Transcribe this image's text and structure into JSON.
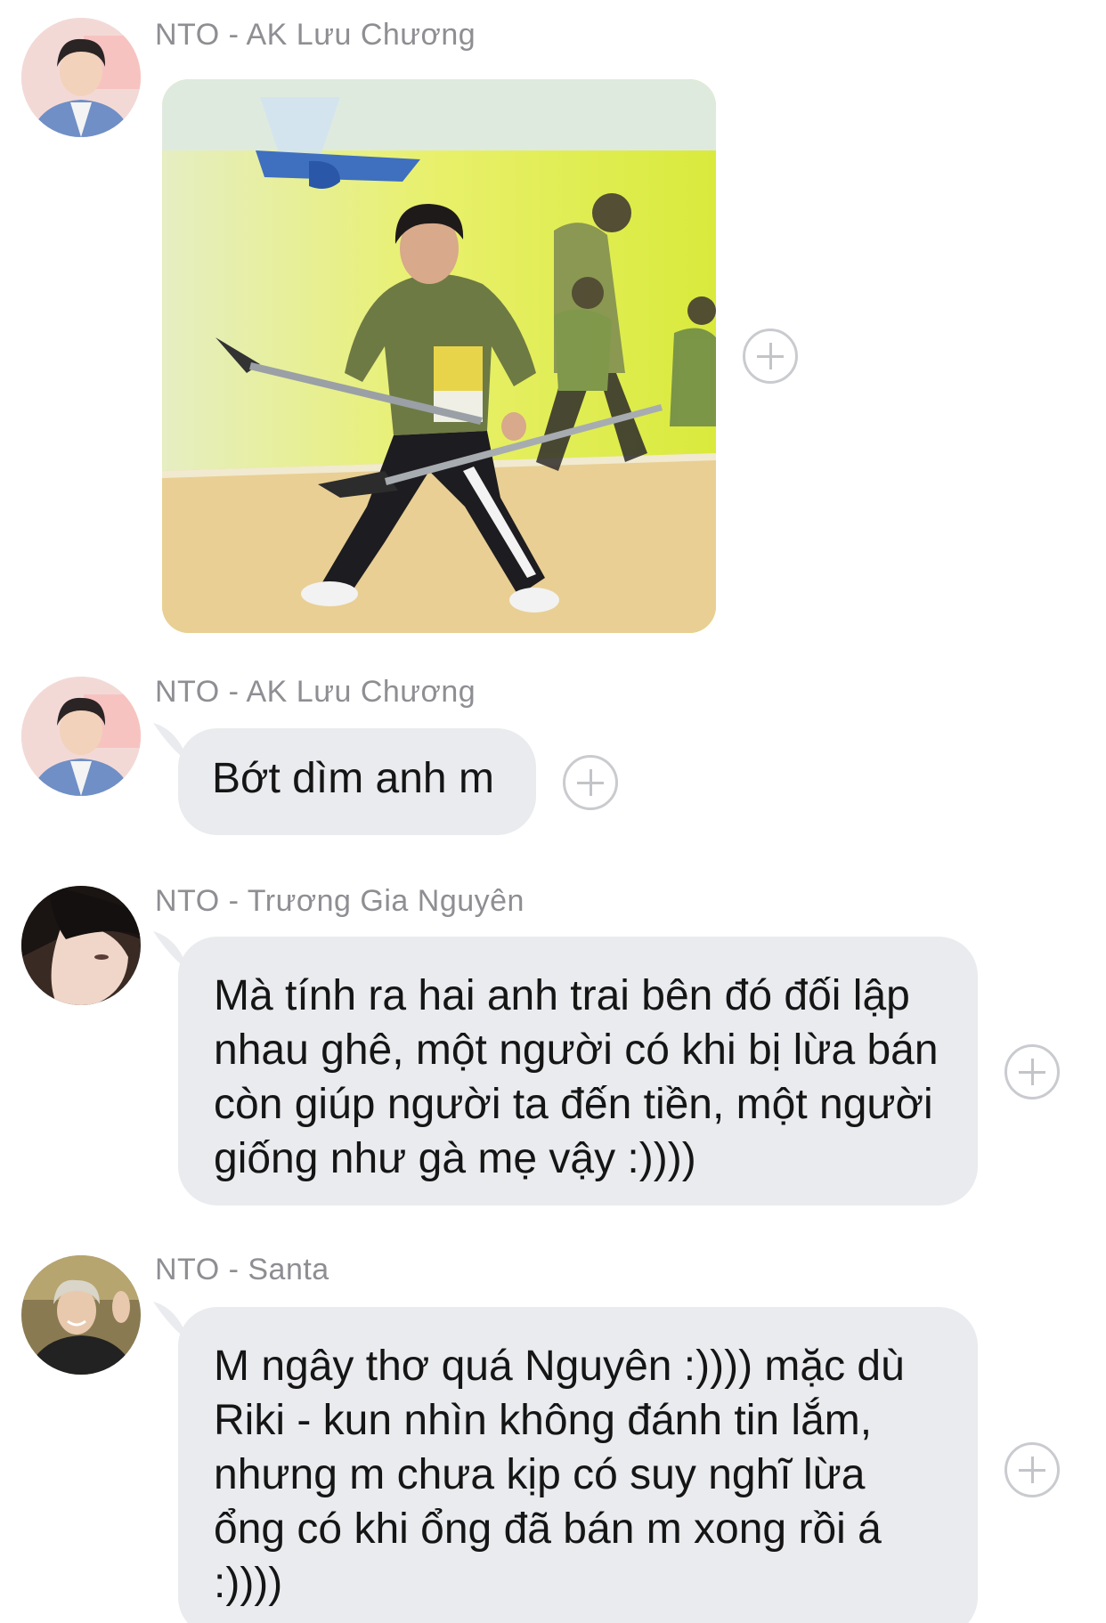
{
  "messages": [
    {
      "sender": "NTO - AK Lưu Chương",
      "type": "image",
      "image_desc": "photo-attachment",
      "react_icon": "plus-circle-icon"
    },
    {
      "sender": "NTO - AK Lưu Chương",
      "type": "text",
      "text": "Bớt dìm anh m",
      "react_icon": "plus-circle-icon"
    },
    {
      "sender": "NTO - Trương Gia Nguyên",
      "type": "text",
      "text": "Mà tính ra hai anh trai bên đó đối lập nhau ghê, một người có khi bị lừa bán còn giúp người ta đến tiền, một người giống như gà mẹ vậy :))))",
      "react_icon": "plus-circle-icon"
    },
    {
      "sender": "NTO - Santa",
      "type": "text",
      "text": "M ngây thơ quá Nguyên :)))) mặc dù Riki - kun nhìn không đánh tin lắm, nhưng m chưa kịp có suy nghĩ lừa ổng có khi ổng đã bán m xong rồi á :))))",
      "react_icon": "plus-circle-icon"
    }
  ],
  "colors": {
    "bubble": "#e9ebee",
    "sender_name": "#8e8e93",
    "text": "#151515",
    "background": "#ffffff"
  }
}
